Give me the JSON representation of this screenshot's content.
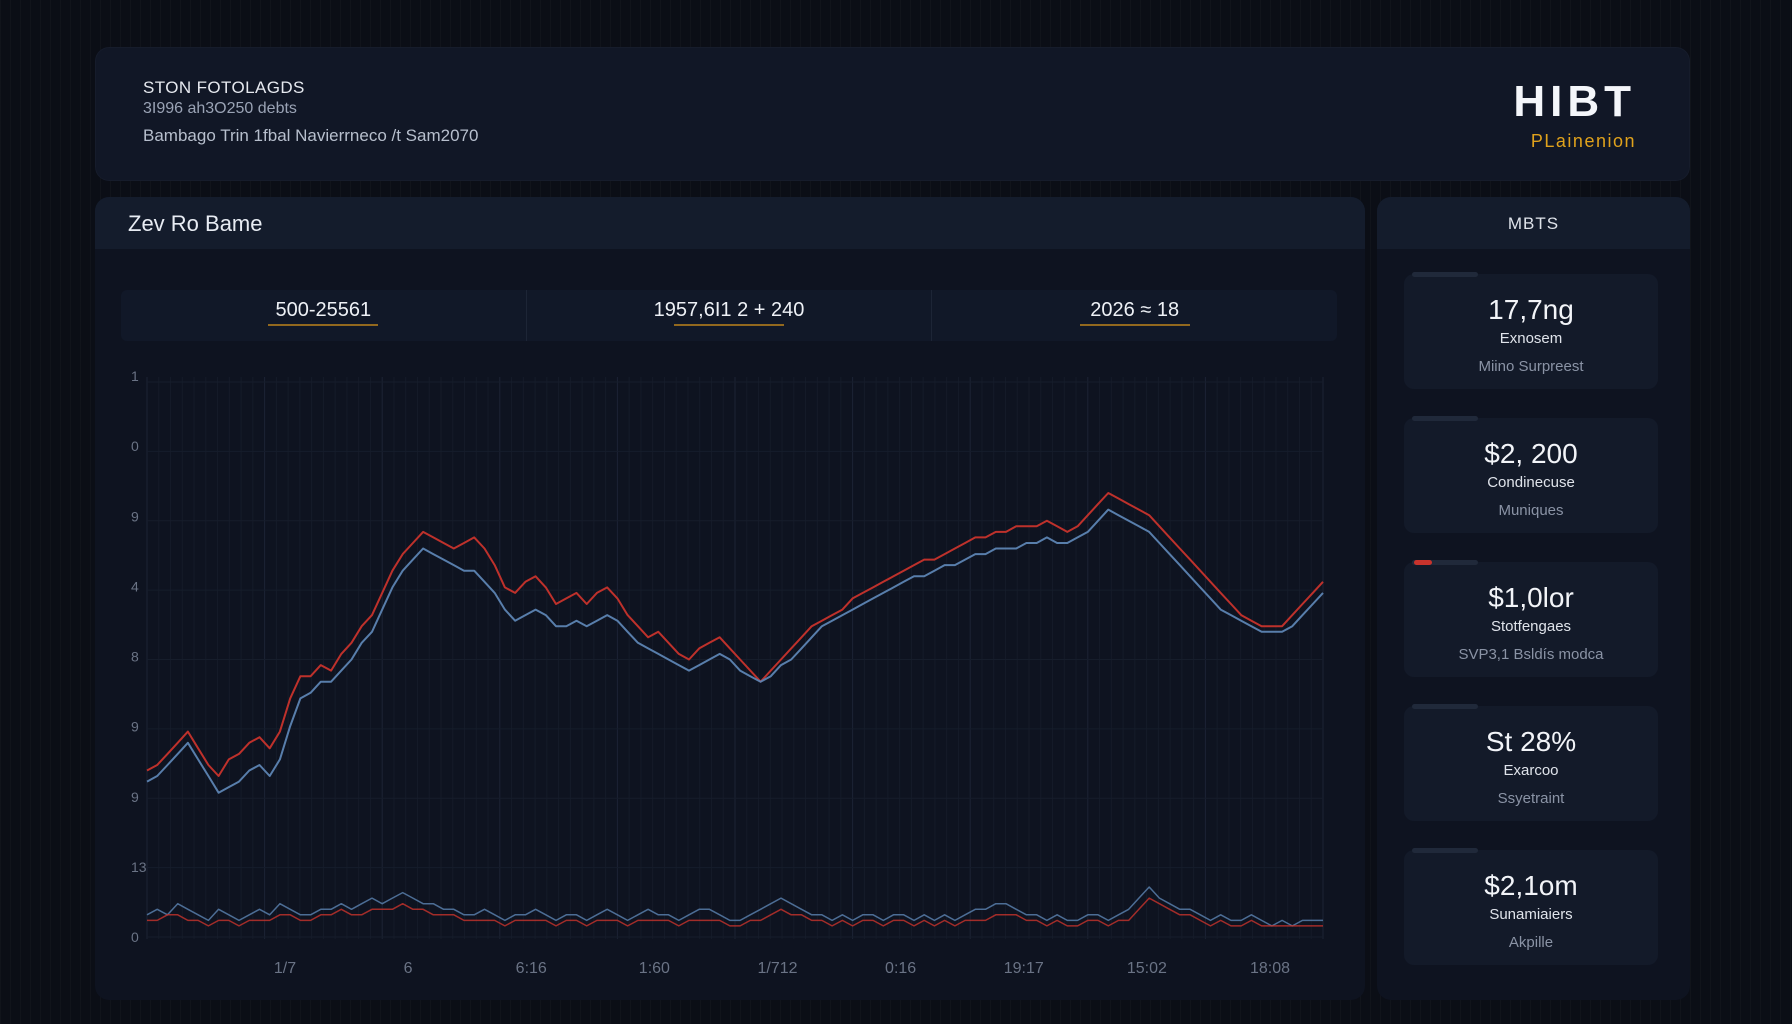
{
  "header": {
    "title": "STON FOTOLAGDS",
    "subtitle": "3I996 ah3O250 debts",
    "line": "Bambago Trin 1fbal Navierrneco /t Sam2070",
    "brand_name": "HIBT",
    "brand_sub": "PLainenion"
  },
  "panel": {
    "title": "Zev Ro Bame",
    "stats": [
      "500-25561",
      "1957,6I1 2 + 240",
      "2026 ≈ 18"
    ]
  },
  "sidebar": {
    "title": "MBTS",
    "cards": [
      {
        "value": "17,7ng",
        "label": "Exnosem",
        "sub": "Miino Surpreest"
      },
      {
        "value": "$2, 200",
        "label": "Condinecuse",
        "sub": "Muniques"
      },
      {
        "value": "$1,0lor",
        "label": "Stotfengaes",
        "sub": "SVP3,1 Bsldís modca"
      },
      {
        "value": "St 28%",
        "label": "Exarcoo",
        "sub": "Ssyetraint"
      },
      {
        "value": "$2,1om",
        "label": "Sunamiaiers",
        "sub": "Akpille"
      }
    ]
  },
  "colors": {
    "series_red": "#c8332c",
    "series_blue": "#5d84b3",
    "accent": "#e0a21c"
  },
  "chart_data": {
    "type": "line",
    "xlabel": "",
    "ylabel": "",
    "x_ticks": [
      "1/7",
      "6",
      "6:16",
      "1:60",
      "1/712",
      "0:16",
      "19:17",
      "15:02",
      "18:08"
    ],
    "y_ticks": [
      "1",
      "0",
      "9",
      "4",
      "8",
      "9",
      "9",
      "13",
      "0"
    ],
    "ylim": [
      0,
      100
    ],
    "grid": true,
    "x": [
      0,
      1,
      2,
      3,
      4,
      5,
      6,
      7,
      8,
      9,
      10,
      11,
      12,
      13,
      14,
      15,
      16,
      17,
      18,
      19,
      20,
      21,
      22,
      23,
      24,
      25,
      26,
      27,
      28,
      29,
      30,
      31,
      32,
      33,
      34,
      35,
      36,
      37,
      38,
      39,
      40,
      41,
      42,
      43,
      44,
      45,
      46,
      47,
      48,
      49,
      50,
      51,
      52,
      53,
      54,
      55,
      56,
      57,
      58,
      59,
      60,
      61,
      62,
      63,
      64,
      65,
      66,
      67,
      68,
      69,
      70,
      71,
      72,
      73,
      74,
      75,
      76,
      77,
      78,
      79,
      80,
      81,
      82,
      83,
      84,
      85,
      86,
      87,
      88,
      89,
      90,
      91,
      92,
      93,
      94,
      95,
      96,
      97,
      98,
      99,
      100,
      101,
      102,
      103,
      104,
      105,
      106,
      107,
      108,
      109,
      110,
      111,
      112,
      113,
      114,
      115
    ],
    "series": [
      {
        "values": [
          30,
          31,
          33,
          35,
          37,
          34,
          31,
          29,
          32,
          33,
          35,
          36,
          34,
          37,
          43,
          47,
          47,
          49,
          48,
          51,
          53,
          56,
          58,
          62,
          66,
          69,
          71,
          73,
          72,
          71,
          70,
          71,
          72,
          70,
          67,
          63,
          62,
          64,
          65,
          63,
          60,
          61,
          62,
          60,
          62,
          63,
          61,
          58,
          56,
          54,
          55,
          53,
          51,
          50,
          52,
          53,
          54,
          52,
          50,
          48,
          46,
          48,
          50,
          52,
          54,
          56,
          57,
          58,
          59,
          61,
          62,
          63,
          64,
          65,
          66,
          67,
          68,
          68,
          69,
          70,
          71,
          72,
          72,
          73,
          73,
          74,
          74,
          74,
          75,
          74,
          73,
          74,
          76,
          78,
          80,
          79,
          78,
          77,
          76,
          74,
          72,
          70,
          68,
          66,
          64,
          62,
          60,
          58,
          57,
          56,
          56,
          56,
          58,
          60,
          62,
          64
        ]
      },
      {
        "values": [
          28,
          29,
          31,
          33,
          35,
          32,
          29,
          26,
          27,
          28,
          30,
          31,
          29,
          32,
          38,
          43,
          44,
          46,
          46,
          48,
          50,
          53,
          55,
          59,
          63,
          66,
          68,
          70,
          69,
          68,
          67,
          66,
          66,
          64,
          62,
          59,
          57,
          58,
          59,
          58,
          56,
          56,
          57,
          56,
          57,
          58,
          57,
          55,
          53,
          52,
          51,
          50,
          49,
          48,
          49,
          50,
          51,
          50,
          48,
          47,
          46,
          47,
          49,
          50,
          52,
          54,
          56,
          57,
          58,
          59,
          60,
          61,
          62,
          63,
          64,
          65,
          65,
          66,
          67,
          67,
          68,
          69,
          69,
          70,
          70,
          70,
          71,
          71,
          72,
          71,
          71,
          72,
          73,
          75,
          77,
          76,
          75,
          74,
          73,
          71,
          69,
          67,
          65,
          63,
          61,
          59,
          58,
          57,
          56,
          55,
          55,
          55,
          56,
          58,
          60,
          62
        ]
      },
      {
        "values": [
          4,
          5,
          4,
          6,
          5,
          4,
          3,
          5,
          4,
          3,
          4,
          5,
          4,
          6,
          5,
          4,
          4,
          5,
          5,
          6,
          5,
          6,
          7,
          6,
          7,
          8,
          7,
          6,
          6,
          5,
          5,
          4,
          4,
          5,
          4,
          3,
          4,
          4,
          5,
          4,
          3,
          4,
          4,
          3,
          4,
          5,
          4,
          3,
          4,
          5,
          4,
          4,
          3,
          4,
          5,
          5,
          4,
          3,
          3,
          4,
          5,
          6,
          7,
          6,
          5,
          4,
          4,
          3,
          4,
          3,
          4,
          4,
          3,
          4,
          4,
          3,
          4,
          3,
          4,
          3,
          4,
          5,
          5,
          6,
          6,
          5,
          4,
          4,
          3,
          4,
          3,
          3,
          4,
          4,
          3,
          4,
          5,
          7,
          9,
          7,
          6,
          5,
          5,
          4,
          3,
          4,
          3,
          3,
          4,
          3,
          2,
          3,
          2,
          3,
          3,
          3
        ]
      },
      {
        "values": [
          3,
          3,
          4,
          4,
          3,
          3,
          2,
          3,
          3,
          2,
          3,
          3,
          3,
          4,
          4,
          3,
          3,
          4,
          4,
          5,
          4,
          4,
          5,
          5,
          5,
          6,
          5,
          5,
          4,
          4,
          4,
          3,
          3,
          3,
          3,
          2,
          3,
          3,
          3,
          3,
          2,
          3,
          3,
          2,
          3,
          3,
          3,
          2,
          3,
          3,
          3,
          3,
          2,
          3,
          3,
          3,
          3,
          2,
          2,
          3,
          3,
          4,
          5,
          4,
          4,
          3,
          3,
          2,
          3,
          2,
          3,
          3,
          2,
          3,
          3,
          2,
          3,
          2,
          3,
          2,
          3,
          3,
          3,
          4,
          4,
          4,
          3,
          3,
          2,
          3,
          2,
          2,
          3,
          3,
          2,
          3,
          3,
          5,
          7,
          6,
          5,
          4,
          4,
          3,
          2,
          3,
          2,
          2,
          3,
          2,
          2,
          2,
          2,
          2,
          2,
          2
        ]
      }
    ]
  }
}
